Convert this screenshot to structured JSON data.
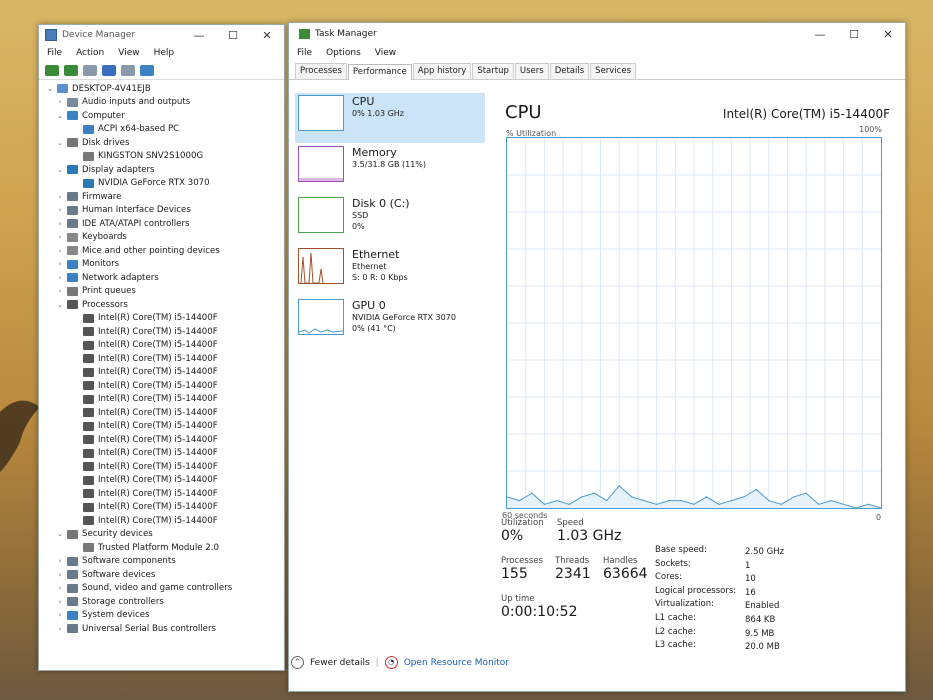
{
  "device_manager": {
    "title": "Device Manager",
    "menu": [
      "File",
      "Action",
      "View",
      "Help"
    ],
    "tree": [
      {
        "level": 0,
        "exp": "v",
        "label": "DESKTOP-4V41EJB",
        "icon": "computer-icon",
        "color": "#5a8fd0"
      },
      {
        "level": 1,
        "exp": ">",
        "label": "Audio inputs and outputs",
        "icon": "speaker-icon",
        "color": "#7a8a9a"
      },
      {
        "level": 1,
        "exp": "v",
        "label": "Computer",
        "icon": "monitor-icon",
        "color": "#3b82c4"
      },
      {
        "level": 2,
        "exp": "",
        "label": "ACPI x64-based PC",
        "icon": "monitor-icon",
        "color": "#3b82c4"
      },
      {
        "level": 1,
        "exp": "v",
        "label": "Disk drives",
        "icon": "disk-icon",
        "color": "#777"
      },
      {
        "level": 2,
        "exp": "",
        "label": "KINGSTON SNV2S1000G",
        "icon": "disk-icon",
        "color": "#777"
      },
      {
        "level": 1,
        "exp": "v",
        "label": "Display adapters",
        "icon": "display-icon",
        "color": "#2a7ab8"
      },
      {
        "level": 2,
        "exp": "",
        "label": "NVIDIA GeForce RTX 3070",
        "icon": "display-icon",
        "color": "#2a7ab8"
      },
      {
        "level": 1,
        "exp": ">",
        "label": "Firmware",
        "icon": "chip-icon",
        "color": "#6a7a8a"
      },
      {
        "level": 1,
        "exp": ">",
        "label": "Human Interface Devices",
        "icon": "hid-icon",
        "color": "#6a7a8a"
      },
      {
        "level": 1,
        "exp": ">",
        "label": "IDE ATA/ATAPI controllers",
        "icon": "controller-icon",
        "color": "#6a7a8a"
      },
      {
        "level": 1,
        "exp": ">",
        "label": "Keyboards",
        "icon": "keyboard-icon",
        "color": "#888"
      },
      {
        "level": 1,
        "exp": ">",
        "label": "Mice and other pointing devices",
        "icon": "mouse-icon",
        "color": "#888"
      },
      {
        "level": 1,
        "exp": ">",
        "label": "Monitors",
        "icon": "monitor-icon",
        "color": "#3b82c4"
      },
      {
        "level": 1,
        "exp": ">",
        "label": "Network adapters",
        "icon": "network-icon",
        "color": "#3b82c4"
      },
      {
        "level": 1,
        "exp": ">",
        "label": "Print queues",
        "icon": "printer-icon",
        "color": "#777"
      },
      {
        "level": 1,
        "exp": "v",
        "label": "Processors",
        "icon": "processor-icon",
        "color": "#555"
      },
      {
        "level": 2,
        "exp": "",
        "label": "Intel(R) Core(TM) i5-14400F",
        "icon": "processor-icon",
        "color": "#555"
      },
      {
        "level": 2,
        "exp": "",
        "label": "Intel(R) Core(TM) i5-14400F",
        "icon": "processor-icon",
        "color": "#555"
      },
      {
        "level": 2,
        "exp": "",
        "label": "Intel(R) Core(TM) i5-14400F",
        "icon": "processor-icon",
        "color": "#555"
      },
      {
        "level": 2,
        "exp": "",
        "label": "Intel(R) Core(TM) i5-14400F",
        "icon": "processor-icon",
        "color": "#555"
      },
      {
        "level": 2,
        "exp": "",
        "label": "Intel(R) Core(TM) i5-14400F",
        "icon": "processor-icon",
        "color": "#555"
      },
      {
        "level": 2,
        "exp": "",
        "label": "Intel(R) Core(TM) i5-14400F",
        "icon": "processor-icon",
        "color": "#555"
      },
      {
        "level": 2,
        "exp": "",
        "label": "Intel(R) Core(TM) i5-14400F",
        "icon": "processor-icon",
        "color": "#555"
      },
      {
        "level": 2,
        "exp": "",
        "label": "Intel(R) Core(TM) i5-14400F",
        "icon": "processor-icon",
        "color": "#555"
      },
      {
        "level": 2,
        "exp": "",
        "label": "Intel(R) Core(TM) i5-14400F",
        "icon": "processor-icon",
        "color": "#555"
      },
      {
        "level": 2,
        "exp": "",
        "label": "Intel(R) Core(TM) i5-14400F",
        "icon": "processor-icon",
        "color": "#555"
      },
      {
        "level": 2,
        "exp": "",
        "label": "Intel(R) Core(TM) i5-14400F",
        "icon": "processor-icon",
        "color": "#555"
      },
      {
        "level": 2,
        "exp": "",
        "label": "Intel(R) Core(TM) i5-14400F",
        "icon": "processor-icon",
        "color": "#555"
      },
      {
        "level": 2,
        "exp": "",
        "label": "Intel(R) Core(TM) i5-14400F",
        "icon": "processor-icon",
        "color": "#555"
      },
      {
        "level": 2,
        "exp": "",
        "label": "Intel(R) Core(TM) i5-14400F",
        "icon": "processor-icon",
        "color": "#555"
      },
      {
        "level": 2,
        "exp": "",
        "label": "Intel(R) Core(TM) i5-14400F",
        "icon": "processor-icon",
        "color": "#555"
      },
      {
        "level": 2,
        "exp": "",
        "label": "Intel(R) Core(TM) i5-14400F",
        "icon": "processor-icon",
        "color": "#555"
      },
      {
        "level": 1,
        "exp": "v",
        "label": "Security devices",
        "icon": "security-icon",
        "color": "#777"
      },
      {
        "level": 2,
        "exp": "",
        "label": "Trusted Platform Module 2.0",
        "icon": "security-icon",
        "color": "#777"
      },
      {
        "level": 1,
        "exp": ">",
        "label": "Software components",
        "icon": "component-icon",
        "color": "#6a7a8a"
      },
      {
        "level": 1,
        "exp": ">",
        "label": "Software devices",
        "icon": "component-icon",
        "color": "#6a7a8a"
      },
      {
        "level": 1,
        "exp": ">",
        "label": "Sound, video and game controllers",
        "icon": "speaker-icon",
        "color": "#6a7a8a"
      },
      {
        "level": 1,
        "exp": ">",
        "label": "Storage controllers",
        "icon": "storage-icon",
        "color": "#6a7a8a"
      },
      {
        "level": 1,
        "exp": ">",
        "label": "System devices",
        "icon": "system-icon",
        "color": "#3b82c4"
      },
      {
        "level": 1,
        "exp": ">",
        "label": "Universal Serial Bus controllers",
        "icon": "usb-icon",
        "color": "#6a7a8a"
      }
    ]
  },
  "task_manager": {
    "title": "Task Manager",
    "menu": [
      "File",
      "Options",
      "View"
    ],
    "tabs": [
      "Processes",
      "Performance",
      "App history",
      "Startup",
      "Users",
      "Details",
      "Services"
    ],
    "active_tab": "Performance",
    "side": [
      {
        "name": "CPU",
        "sub1": "0% 1.03 GHz",
        "sub2": "",
        "color": "#4b9bcf"
      },
      {
        "name": "Memory",
        "sub1": "3.5/31.8 GB (11%)",
        "sub2": "",
        "color": "#9b4fb0"
      },
      {
        "name": "Disk 0 (C:)",
        "sub1": "SSD",
        "sub2": "0%",
        "color": "#4aa54a"
      },
      {
        "name": "Ethernet",
        "sub1": "Ethernet",
        "sub2": "S: 0 R: 0 Kbps",
        "color": "#a0522d"
      },
      {
        "name": "GPU 0",
        "sub1": "NVIDIA GeForce RTX 3070",
        "sub2": "0% (41 °C)",
        "color": "#4b9bcf"
      }
    ],
    "main": {
      "title": "CPU",
      "cpu_name": "Intel(R) Core(TM) i5-14400F",
      "util_label": "% Utilization",
      "pct_max": "100%",
      "time_label": "60 seconds",
      "zero": "0"
    },
    "stats": {
      "utilization_label": "Utilization",
      "utilization": "0%",
      "speed_label": "Speed",
      "speed": "1.03 GHz",
      "processes_label": "Processes",
      "processes": "155",
      "threads_label": "Threads",
      "threads": "2341",
      "handles_label": "Handles",
      "handles": "63664",
      "uptime_label": "Up time",
      "uptime": "0:00:10:52"
    },
    "specs": [
      [
        "Base speed:",
        "2.50 GHz"
      ],
      [
        "Sockets:",
        "1"
      ],
      [
        "Cores:",
        "10"
      ],
      [
        "Logical processors:",
        "16"
      ],
      [
        "Virtualization:",
        "Enabled"
      ],
      [
        "L1 cache:",
        "864 KB"
      ],
      [
        "L2 cache:",
        "9.5 MB"
      ],
      [
        "L3 cache:",
        "20.0 MB"
      ]
    ],
    "footer": {
      "fewer": "Fewer details",
      "resource": "Open Resource Monitor"
    }
  },
  "chart_data": {
    "type": "line",
    "title": "CPU",
    "xlabel": "60 seconds",
    "ylabel": "% Utilization",
    "ylim": [
      0,
      100
    ],
    "x": [
      0,
      2,
      4,
      6,
      8,
      10,
      12,
      14,
      16,
      18,
      20,
      22,
      24,
      26,
      28,
      30,
      32,
      34,
      36,
      38,
      40,
      42,
      44,
      46,
      48,
      50,
      52,
      54,
      56,
      58,
      60
    ],
    "series": [
      {
        "values": [
          3,
          2,
          4,
          1,
          2,
          1,
          3,
          4,
          2,
          6,
          3,
          2,
          1,
          2,
          2,
          1,
          3,
          1,
          2,
          3,
          5,
          2,
          1,
          3,
          4,
          1,
          2,
          1,
          0,
          1,
          0
        ]
      }
    ]
  }
}
